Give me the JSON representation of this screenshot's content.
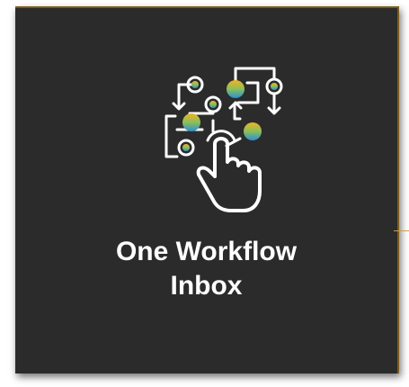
{
  "tile": {
    "title_line1": "One Workflow",
    "title_line2": "Inbox",
    "icon": "workflow-touch-icon",
    "colors": {
      "background": "#2b2b2b",
      "border": "#7a5c1a",
      "text": "#ffffff",
      "accent_gold": "#f0b323",
      "accent_blue": "#2a8fd8"
    }
  }
}
